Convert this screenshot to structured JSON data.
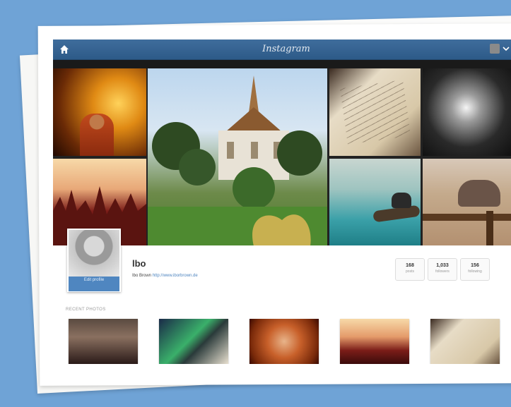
{
  "window": {
    "title": "Instagram"
  },
  "profile": {
    "caption": "Edit profile",
    "name": "lbo",
    "bio_name": "Ibo Brown",
    "bio_link": "http://www.iborbrown.de"
  },
  "stats": [
    {
      "num": "168",
      "label": "posts"
    },
    {
      "num": "1,033",
      "label": "followers"
    },
    {
      "num": "156",
      "label": "following"
    }
  ],
  "recent": {
    "label": "Recent photos"
  },
  "icons": [
    "home-icon",
    "user-avatar",
    "chevron-down-icon"
  ],
  "colors": {
    "topbar": "#2d5a88",
    "accent": "#4f86c0",
    "background": "#6fa3d6"
  }
}
